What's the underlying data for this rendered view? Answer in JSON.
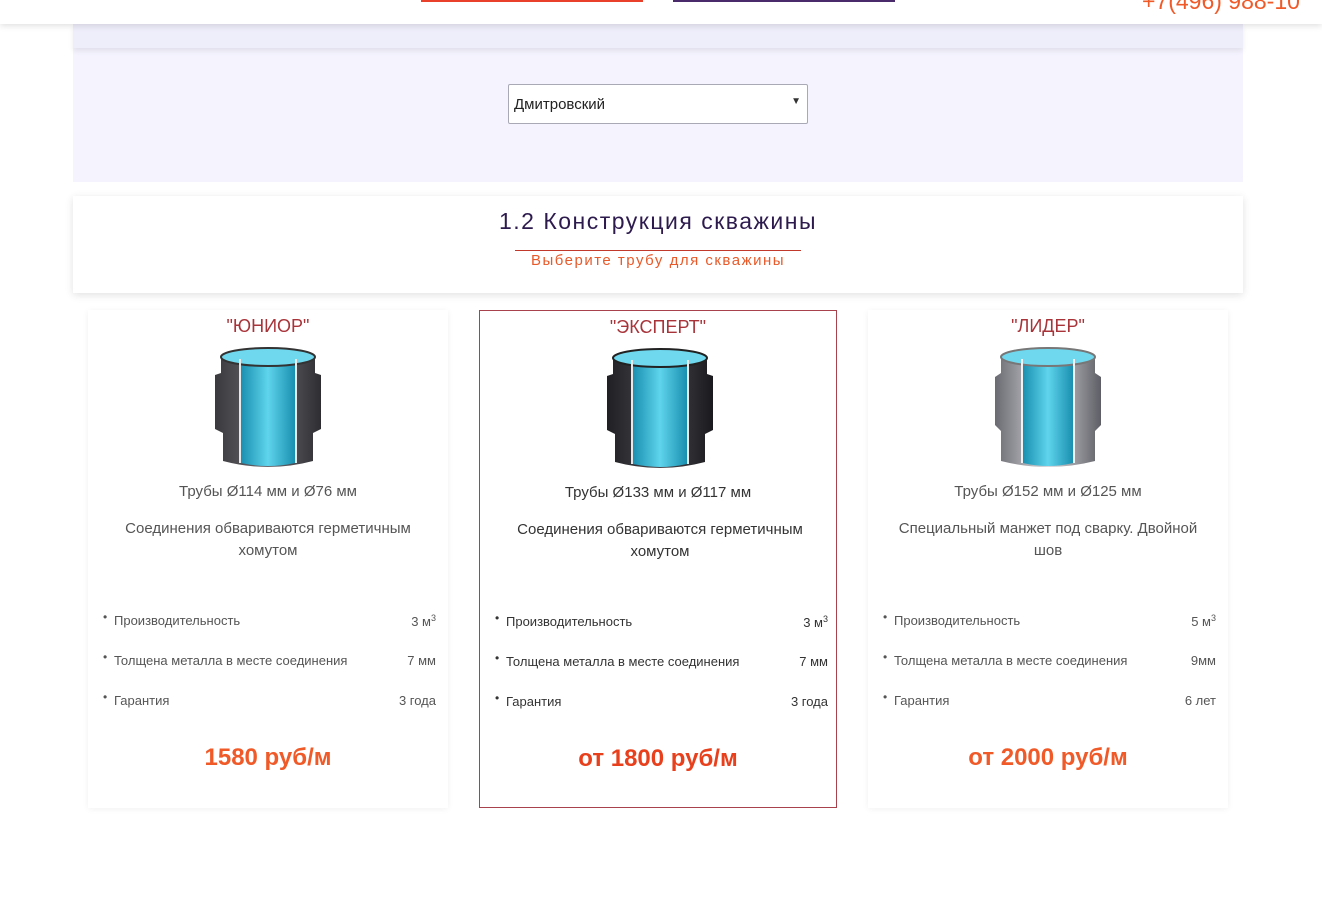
{
  "header": {
    "phone": "+7(496) 988-10"
  },
  "district": {
    "selected": "Дмитровский"
  },
  "section": {
    "title": "1.2 Конструкция скважины",
    "subtitle": "Выберите трубу для скважины"
  },
  "cards": [
    {
      "name": "\"ЮНИОР\"",
      "pipes": "Трубы Ø114 мм и Ø76 мм",
      "description": "Соединения обвариваются герметичным хомутом",
      "specs": [
        {
          "label": "Производительность",
          "value": "3 м",
          "sup": "3"
        },
        {
          "label": "Толщена металла в месте соединения",
          "value": "7 мм"
        },
        {
          "label": "Гарантия",
          "value": "3 года"
        }
      ],
      "price": "1580 руб/м",
      "image": "pipe-dark-icon"
    },
    {
      "name": "\"ЭКСПЕРТ\"",
      "pipes": "Трубы Ø133 мм и Ø117 мм",
      "description": "Соединения обвариваются герметичным хомутом",
      "specs": [
        {
          "label": "Производительность",
          "value": "3 м",
          "sup": "3"
        },
        {
          "label": "Толщена металла в месте соединения",
          "value": "7 мм"
        },
        {
          "label": "Гарантия",
          "value": "3 года"
        }
      ],
      "price": "от 1800 руб/м",
      "image": "pipe-black-icon"
    },
    {
      "name": "\"ЛИДЕР\"",
      "pipes": "Трубы Ø152 мм и Ø125 мм",
      "description": "Специальный манжет под сварку. Двойной шов",
      "specs": [
        {
          "label": "Производительность",
          "value": "5 м",
          "sup": "3"
        },
        {
          "label": "Толщена металла в месте соединения",
          "value": "9мм"
        },
        {
          "label": "Гарантия",
          "value": "6 лет"
        }
      ],
      "price": "от 2000 руб/м",
      "image": "pipe-steel-icon"
    }
  ],
  "colors": {
    "accent": "#f05a28",
    "title": "#2d1b4e",
    "card_name": "#a8343a",
    "panel_bg": "#f4f3fe"
  }
}
